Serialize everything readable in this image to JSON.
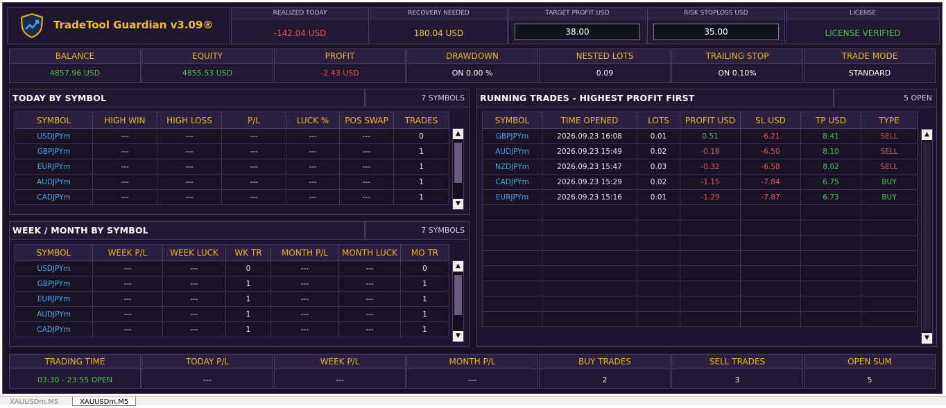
{
  "app": {
    "title": "TradeTool Guardian v3.09®"
  },
  "stats": {
    "realized_label": "REALIZED TODAY",
    "realized_value": "-142.04 USD",
    "recovery_label": "RECOVERY NEEDED",
    "recovery_value": "180.04 USD",
    "target_label": "TARGET PROFIT USD",
    "target_value": "38.00",
    "risk_label": "RISK STOPLOSS USD",
    "risk_value": "35.00",
    "license_label": "LICENSE",
    "license_value": "LICENSE VERIFIED"
  },
  "account": {
    "balance_label": "BALANCE",
    "balance": "4857.96 USD",
    "equity_label": "EQUITY",
    "equity": "4855.53 USD",
    "profit_label": "PROFIT",
    "profit": "-2.43 USD",
    "drawdown_label": "DRAWDOWN",
    "drawdown": "ON  0.00 %",
    "nested_label": "NESTED LOTS",
    "nested": "0.09",
    "trailing_label": "TRAILING STOP",
    "trailing": "ON  0.10%",
    "mode_label": "TRADE MODE",
    "mode": "STANDARD"
  },
  "today": {
    "title": "TODAY BY SYMBOL",
    "count": "7 SYMBOLS",
    "headers": [
      "SYMBOL",
      "HIGH WIN",
      "HIGH LOSS",
      "P/L",
      "LUCK %",
      "POS SWAP",
      "TRADES"
    ],
    "rows": [
      [
        "USDJPYm",
        "---",
        "---",
        "---",
        "---",
        "---",
        "0"
      ],
      [
        "GBPJPYm",
        "---",
        "---",
        "---",
        "---",
        "---",
        "1"
      ],
      [
        "EURJPYm",
        "---",
        "---",
        "---",
        "---",
        "---",
        "1"
      ],
      [
        "AUDJPYm",
        "---",
        "---",
        "---",
        "---",
        "---",
        "1"
      ],
      [
        "CADJPYm",
        "---",
        "---",
        "---",
        "---",
        "---",
        "1"
      ]
    ]
  },
  "week": {
    "title": "WEEK / MONTH BY SYMBOL",
    "count": "7 SYMBOLS",
    "headers": [
      "SYMBOL",
      "WEEK P/L",
      "WEEK LUCK",
      "WK TR",
      "MONTH P/L",
      "MONTH LUCK",
      "MO TR"
    ],
    "rows": [
      [
        "USDJPYm",
        "---",
        "---",
        "0",
        "---",
        "---",
        "0"
      ],
      [
        "GBPJPYm",
        "---",
        "---",
        "1",
        "---",
        "---",
        "1"
      ],
      [
        "EURJPYm",
        "---",
        "---",
        "1",
        "---",
        "---",
        "1"
      ],
      [
        "AUDJPYm",
        "---",
        "---",
        "1",
        "---",
        "---",
        "1"
      ],
      [
        "CADJPYm",
        "---",
        "---",
        "1",
        "---",
        "---",
        "1"
      ]
    ]
  },
  "running": {
    "title": "RUNNING TRADES - HIGHEST PROFIT FIRST",
    "count": "5 OPEN",
    "headers": [
      "SYMBOL",
      "TIME OPENED",
      "LOTS",
      "PROFIT USD",
      "SL USD",
      "TP USD",
      "TYPE"
    ],
    "rows": [
      [
        "GBPJPYm",
        "2026.09.23 16:08",
        "0.01",
        "0.51",
        "-6.21",
        "8.41",
        "SELL"
      ],
      [
        "AUDJPYm",
        "2026.09.23 15:49",
        "0.02",
        "-0.18",
        "-6.50",
        "8.10",
        "SELL"
      ],
      [
        "NZDJPYm",
        "2026.09.23 15:47",
        "0.03",
        "-0.32",
        "-6.58",
        "8.02",
        "SELL"
      ],
      [
        "CADJPYm",
        "2026.09.23 15:29",
        "0.02",
        "-1.15",
        "-7.84",
        "6.75",
        "BUY"
      ],
      [
        "EURJPYm",
        "2026.09.23 15:16",
        "0.01",
        "-1.29",
        "-7.87",
        "6.73",
        "BUY"
      ]
    ]
  },
  "footer": {
    "trading_time_label": "TRADING TIME",
    "trading_time": "03:30 - 23:55  OPEN",
    "today_pl_label": "TODAY P/L",
    "today_pl": "---",
    "week_pl_label": "WEEK P/L",
    "week_pl": "---",
    "month_pl_label": "MONTH P/L",
    "month_pl": "---",
    "buy_label": "BUY TRADES",
    "buy": "2",
    "sell_label": "SELL TRADES",
    "sell": "3",
    "open_label": "OPEN SUM",
    "open": "5"
  },
  "tabs": [
    "XAUUSDm,M5",
    "XAUUSDm,M5"
  ]
}
